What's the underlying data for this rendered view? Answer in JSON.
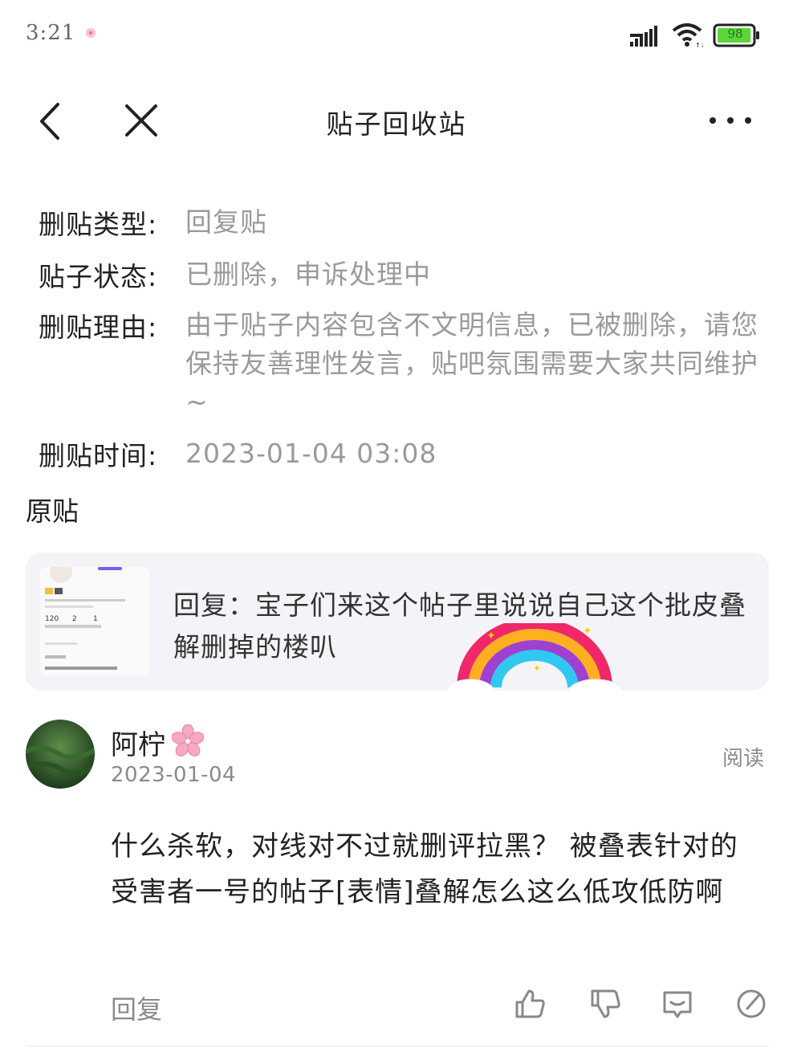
{
  "status_bar": {
    "time": "3:21",
    "battery": "98"
  },
  "nav": {
    "title": "贴子回收站",
    "back_icon": "chevron-left-icon",
    "close_icon": "close-icon",
    "more_icon": "more-icon"
  },
  "info": [
    {
      "label": "删贴类型:",
      "value": "回复贴"
    },
    {
      "label": "贴子状态:",
      "value": "已删除，申诉处理中"
    },
    {
      "label": "删贴理由:",
      "value": "由于贴子内容包含不文明信息，已被删除，请您保持友善理性发言，贴吧氛围需要大家共同维护~"
    },
    {
      "label": "删贴时间:",
      "value": "2023-01-04 03:08"
    }
  ],
  "original": {
    "section_title": "原贴",
    "text": "回复：宝子们来这个帖子里说说自己这个批皮叠解删掉的楼叭",
    "thumb_count_a": "120",
    "thumb_count_b": "2",
    "thumb_count_c": "1"
  },
  "comment": {
    "user": "阿柠",
    "date": "2023-01-04",
    "read": "阅读",
    "text": " 什么杀软，对线对不过就删评拉黑？ 被叠表针对的受害者一号的帖子[表情]叠解怎么这么低攻低防啊",
    "reply": "回复"
  },
  "colors": {
    "accent_gray": "#9a9a9a",
    "battery_green": "#5bd63a",
    "card_bg": "#f4f4f8"
  }
}
